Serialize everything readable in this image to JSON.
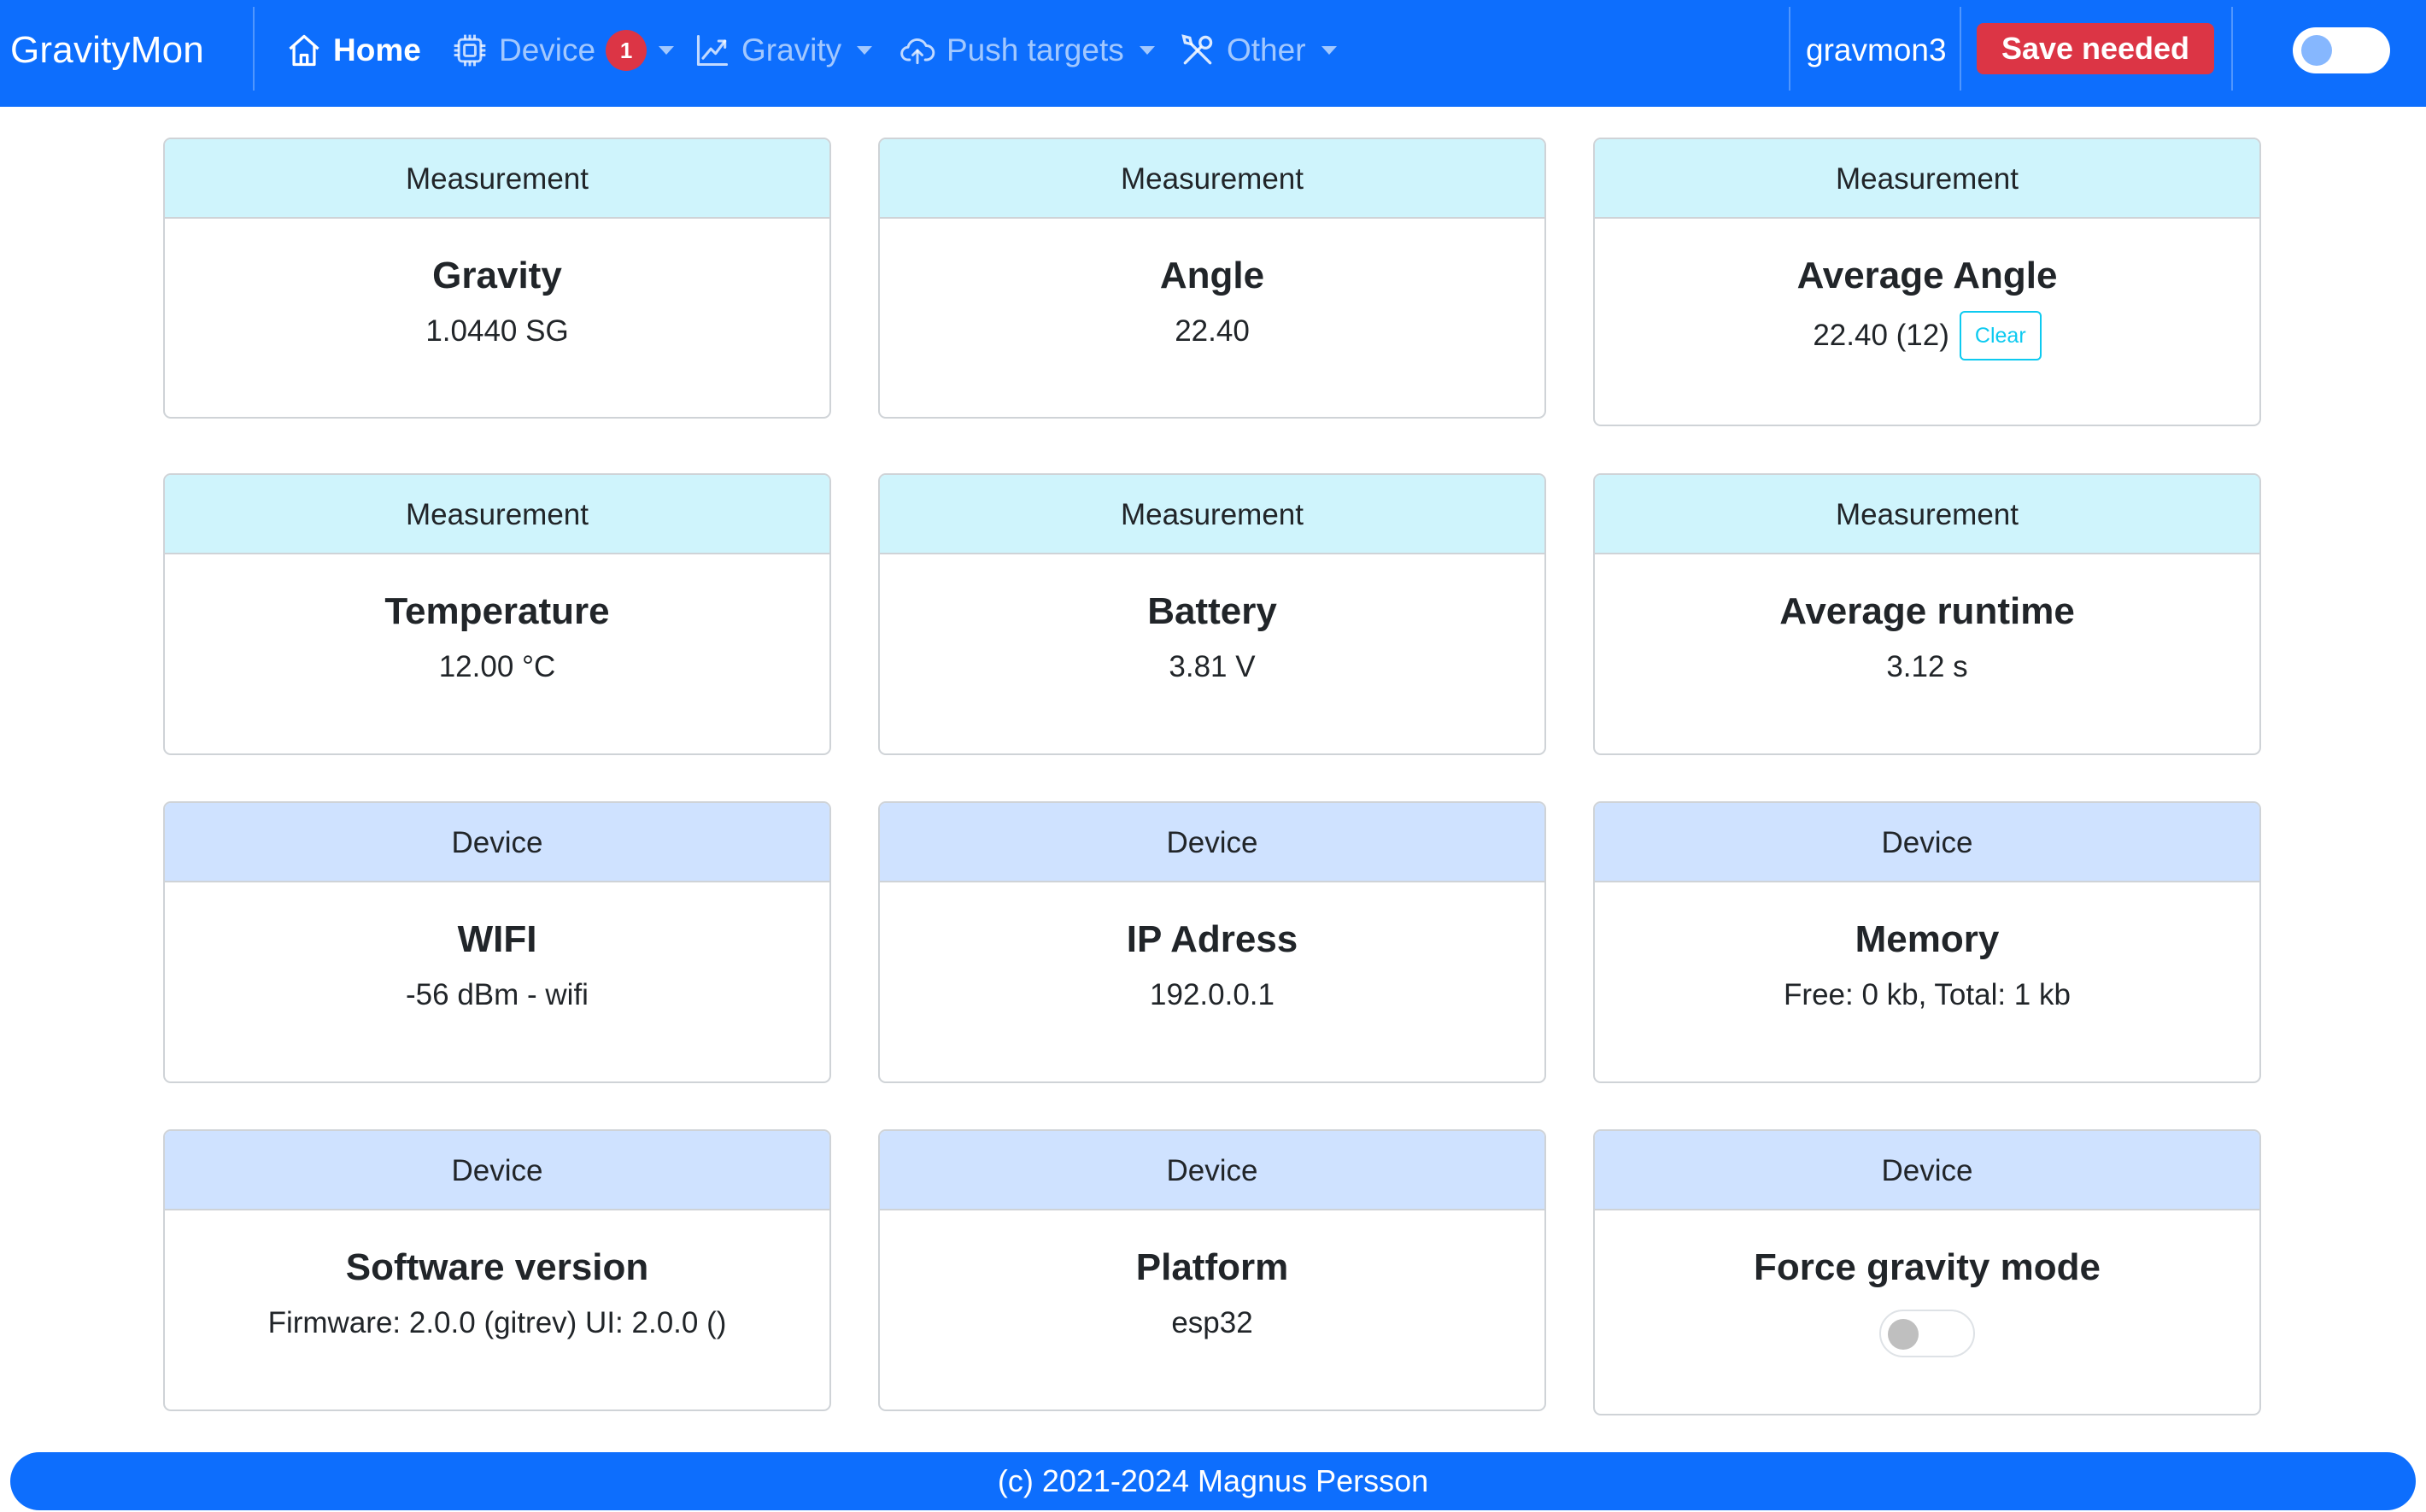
{
  "app": {
    "title": "GravityMon"
  },
  "nav": {
    "home_label": "Home",
    "device_label": "Device",
    "device_badge": "1",
    "gravity_label": "Gravity",
    "push_label": "Push targets",
    "other_label": "Other",
    "hostname": "gravmon3",
    "save_label": "Save needed"
  },
  "colors": {
    "navbar": "#0d6efd",
    "measurement_header": "#cff4fc",
    "device_header": "#cfe2ff",
    "danger": "#dc3545",
    "info": "#0dcaf0"
  },
  "cards": {
    "gravity": {
      "header": "Measurement",
      "title": "Gravity",
      "value": "1.0440 SG"
    },
    "angle": {
      "header": "Measurement",
      "title": "Angle",
      "value": "22.40"
    },
    "avg_angle": {
      "header": "Measurement",
      "title": "Average Angle",
      "value": "22.40 (12)",
      "button": "Clear"
    },
    "temperature": {
      "header": "Measurement",
      "title": "Temperature",
      "value": "12.00 °C"
    },
    "battery": {
      "header": "Measurement",
      "title": "Battery",
      "value": "3.81 V"
    },
    "runtime": {
      "header": "Measurement",
      "title": "Average runtime",
      "value": "3.12 s"
    },
    "wifi": {
      "header": "Device",
      "title": "WIFI",
      "value": "-56 dBm - wifi"
    },
    "ip": {
      "header": "Device",
      "title": "IP Adress",
      "value": "192.0.0.1"
    },
    "memory": {
      "header": "Device",
      "title": "Memory",
      "value": "Free: 0 kb, Total: 1 kb"
    },
    "software": {
      "header": "Device",
      "title": "Software version",
      "value": "Firmware: 2.0.0 (gitrev) UI: 2.0.0 ()"
    },
    "platform": {
      "header": "Device",
      "title": "Platform",
      "value": "esp32"
    },
    "force": {
      "header": "Device",
      "title": "Force gravity mode"
    }
  },
  "footer": {
    "text": "(c) 2021-2024 Magnus Persson"
  }
}
